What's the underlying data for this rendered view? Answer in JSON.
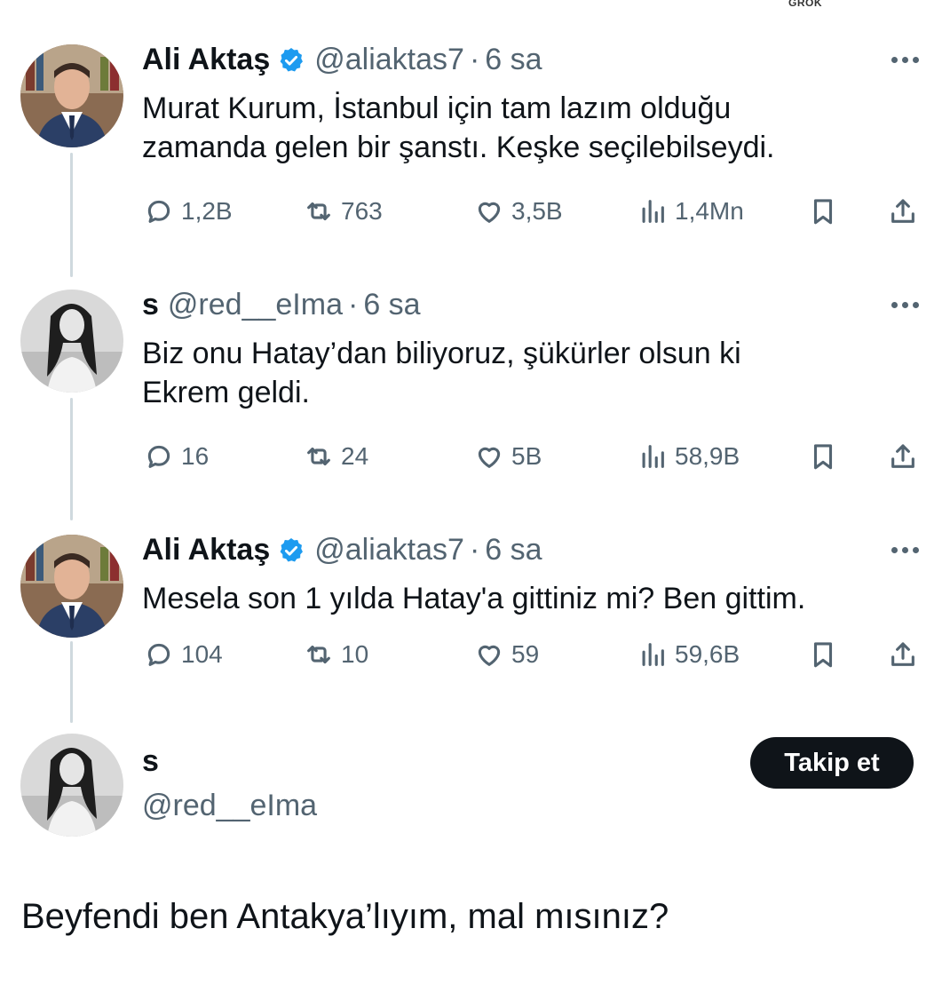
{
  "top_mark": "GROK",
  "tweets": [
    {
      "name": "Ali Aktaş",
      "verified": true,
      "handle": "@aliaktas7",
      "separator": "·",
      "time": "6 sa",
      "text_lines": [
        "Murat Kurum, İstanbul için tam lazım olduğu",
        "zamanda gelen bir şanstı. Keşke seçilebilseydi."
      ],
      "replies": "1,2B",
      "retweets": "763",
      "likes": "3,5B",
      "views": "1,4Mn",
      "avatar": "man-in-suit-photo"
    },
    {
      "name": "s",
      "verified": false,
      "handle": "@red__eIma",
      "separator": "·",
      "time": "6 sa",
      "text_lines": [
        "Biz onu Hatay’dan biliyoruz, şükürler olsun ki",
        "Ekrem geldi."
      ],
      "replies": "16",
      "retweets": "24",
      "likes": "5B",
      "views": "58,9B",
      "avatar": "woman-grayscale-photo"
    },
    {
      "name": "Ali Aktaş",
      "verified": true,
      "handle": "@aliaktas7",
      "separator": "·",
      "time": "6 sa",
      "text_lines": [
        "Mesela son 1 yılda Hatay'a gittiniz mi? Ben gittim."
      ],
      "replies": "104",
      "retweets": "10",
      "likes": "59",
      "views": "59,6B",
      "avatar": "man-in-suit-photo"
    }
  ],
  "profile": {
    "name": "s",
    "handle": "@red__eIma",
    "follow_label": "Takip et"
  },
  "final_text": "Beyfendi ben Antakya’lıyım, mal mısınız?",
  "colors": {
    "text": "#0f1419",
    "secondary": "#536471",
    "verified": "#1d9bf0",
    "thread_line": "#cfd9de",
    "button_bg": "#0f1419"
  }
}
